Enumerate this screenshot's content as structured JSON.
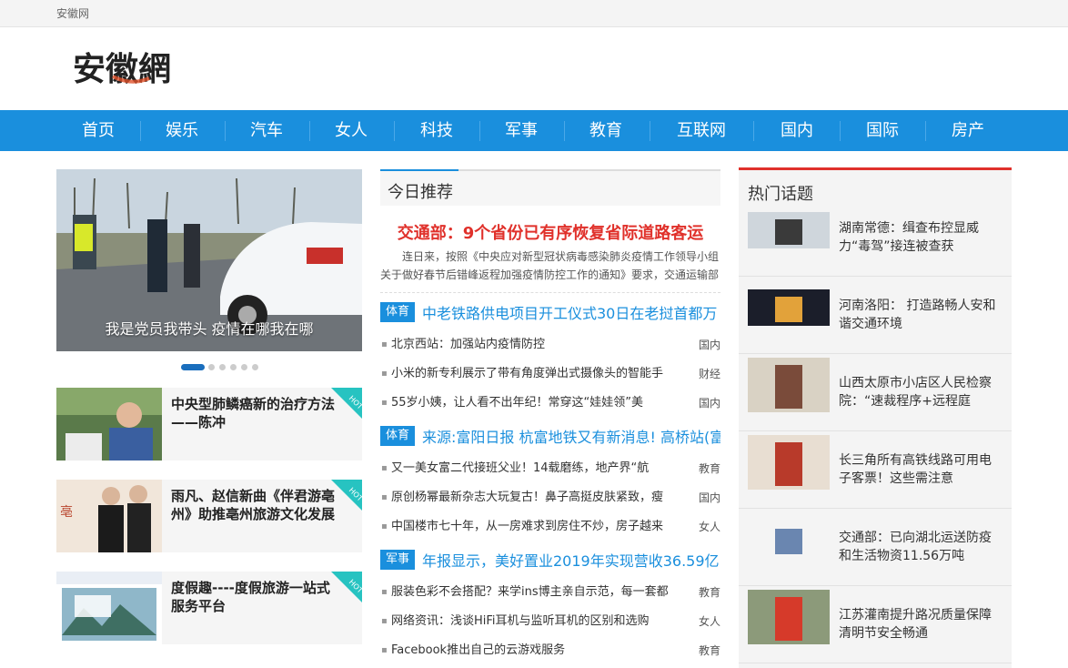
{
  "topbar": {
    "site_name": "安徽网"
  },
  "logo": {
    "text": "安徽網"
  },
  "nav": [
    "首页",
    "娱乐",
    "汽车",
    "女人",
    "科技",
    "军事",
    "教育",
    "互联网",
    "国内",
    "国际",
    "房产"
  ],
  "slider": {
    "caption": "我是党员我带头 疫情在哪我在哪",
    "dots_total": 6,
    "active_dot": 1
  },
  "cards": [
    {
      "title": "中央型肺鳞癌新的治疗方法——陈冲",
      "badge": "HOT"
    },
    {
      "title": "雨凡、赵信新曲《伴君游亳州》助推亳州旅游文化发展",
      "badge": "HOT"
    },
    {
      "title": "度假趣----度假旅游一站式服务平台",
      "badge": "HOT"
    }
  ],
  "recommend": {
    "section_title": "今日推荐",
    "headline": "交通部：9个省份已有序恢复省际道路客运",
    "summary": "连日来，按照《中央应对新型冠状病毒感染肺炎疫情工作领导小组关于做好春节后错峰返程加强疫情防控工作的通知》要求，交通运输部",
    "groups": [
      {
        "tag": "体育",
        "title": "中老铁路供电项目开工仪式30日在老挝首都万",
        "items": [
          {
            "text": "北京西站：加强站内疫情防控",
            "cat": "国内"
          },
          {
            "text": "小米的新专利展示了带有角度弹出式摄像头的智能手",
            "cat": "财经"
          },
          {
            "text": "55岁小姨，让人看不出年纪！常穿这“娃娃领”美",
            "cat": "国内"
          }
        ]
      },
      {
        "tag": "体育",
        "title": "来源:富阳日报 杭富地铁又有新消息! 高桥站(富",
        "items": [
          {
            "text": "又一美女富二代接班父业！14载磨练，地产界“航",
            "cat": "教育"
          },
          {
            "text": "原创杨幂最新杂志大玩复古！鼻子高挺皮肤紧致，瘦",
            "cat": "国内"
          },
          {
            "text": "中国楼市七十年，从一房难求到房住不炒，房子越来",
            "cat": "女人"
          }
        ]
      },
      {
        "tag": "军事",
        "title": "年报显示，美好置业2019年实现营收36.59亿",
        "items": [
          {
            "text": "服装色彩不会搭配？来学ins博主亲自示范，每一套都",
            "cat": "教育"
          },
          {
            "text": "网络资讯：浅谈HiFi耳机与监听耳机的区别和选购",
            "cat": "女人"
          },
          {
            "text": "Facebook推出自己的云游戏服务",
            "cat": "教育"
          }
        ]
      }
    ]
  },
  "hot_topics": {
    "title": "热门话题",
    "items": [
      "湖南常德：缉查布控显威力“毒驾”接连被查获",
      "河南洛阳：  打造路畅人安和谐交通环境",
      "山西太原市小店区人民检察院：“速裁程序+远程庭",
      "长三角所有高铁线路可用电子客票！这些需注意",
      "交通部：已向湖北运送防疫和生活物资11.56万吨",
      "江苏灌南提升路况质量保障清明节安全畅通"
    ]
  }
}
